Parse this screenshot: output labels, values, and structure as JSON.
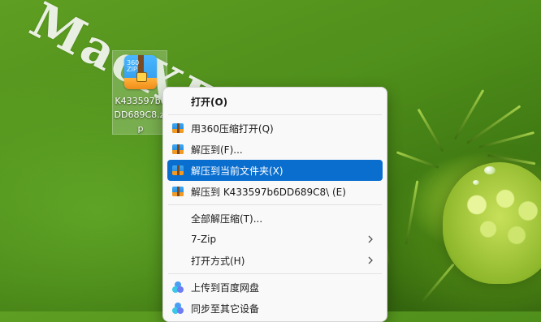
{
  "watermark": "MacXF.com",
  "desktop_icon": {
    "label": "K433597b6DD689C8.zip",
    "badge_text": "360\nZIP"
  },
  "context_menu": {
    "items": [
      {
        "label": "打开(O)",
        "icon": "none",
        "bold": true
      },
      {
        "separator": true
      },
      {
        "label": "用360压缩打开(Q)",
        "icon": "archive-icon"
      },
      {
        "label": "解压到(F)...",
        "icon": "archive-icon"
      },
      {
        "label": "解压到当前文件夹(X)",
        "icon": "archive-icon",
        "active": true
      },
      {
        "label": "解压到 K433597b6DD689C8\\ (E)",
        "icon": "archive-icon"
      },
      {
        "separator": true
      },
      {
        "label": "全部解压缩(T)...",
        "icon": "none"
      },
      {
        "label": "7-Zip",
        "icon": "none",
        "submenu": true
      },
      {
        "label": "打开方式(H)",
        "icon": "none",
        "submenu": true
      },
      {
        "separator": true
      },
      {
        "label": "上传到百度网盘",
        "icon": "baidu-netdisk-icon"
      },
      {
        "label": "同步至其它设备",
        "icon": "baidu-netdisk-icon"
      }
    ]
  },
  "colors": {
    "highlight": "#0a6ecf",
    "menu_bg": "#f9f9f9"
  }
}
